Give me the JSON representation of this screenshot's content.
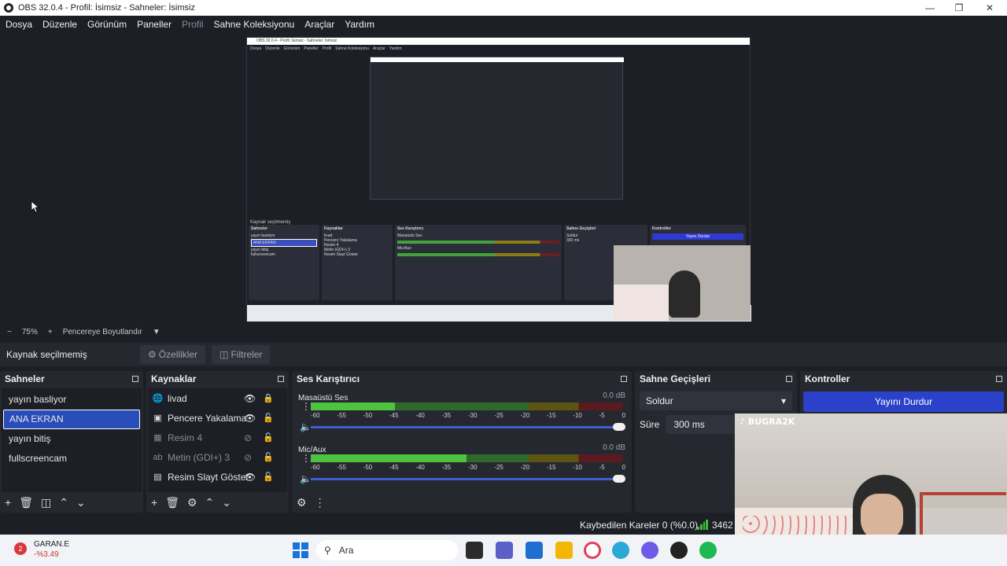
{
  "window": {
    "title": "OBS 32.0.4 - Profil: İsimsiz - Sahneler: İsimsiz"
  },
  "menu": [
    "Dosya",
    "Düzenle",
    "Görünüm",
    "Paneller",
    "Profil",
    "Sahne Koleksiyonu",
    "Araçlar",
    "Yardım"
  ],
  "preview": {
    "zoom": "75%",
    "fit_label": "Pencereye Boyutlandır"
  },
  "context": {
    "label": "Kaynak seçilmemiş",
    "properties": "Özellikler",
    "filters": "Filtreler"
  },
  "scenes": {
    "title": "Sahneler",
    "items": [
      "yayın basliyor",
      "ANA EKRAN",
      "yayın bitiş",
      "fullscreencam"
    ],
    "selected_index": 1
  },
  "sources": {
    "title": "Kaynaklar",
    "items": [
      {
        "label": "livad",
        "icon": "globe-icon",
        "visible": true
      },
      {
        "label": "Pencere Yakalama",
        "icon": "window-icon",
        "visible": true
      },
      {
        "label": "Resim 4",
        "icon": "image-icon",
        "visible": false
      },
      {
        "label": "Metin (GDI+) 3",
        "icon": "text-icon",
        "visible": false
      },
      {
        "label": "Resim Slayt Göster",
        "icon": "slideshow-icon",
        "visible": true
      }
    ]
  },
  "mixer": {
    "title": "Ses Karıştırıcı",
    "scale": [
      "-60",
      "-55",
      "-50",
      "-45",
      "-40",
      "-35",
      "-30",
      "-25",
      "-20",
      "-15",
      "-10",
      "-5",
      "0"
    ],
    "channels": [
      {
        "name": "Masaüstü Ses",
        "db": "0.0 dB",
        "level": 0.27,
        "peak": 0.29
      },
      {
        "name": "Mic/Aux",
        "db": "0.0 dB",
        "level": 0.5,
        "peak": 0.52
      }
    ]
  },
  "transitions": {
    "title": "Sahne Geçişleri",
    "selected": "Soldur",
    "duration_label": "Süre",
    "duration_value": "300 ms"
  },
  "controls": {
    "title": "Kontroller",
    "stop_stream": "Yayını Durdur"
  },
  "status": {
    "dropped_frames": "Kaybedilen Kareler 0 (%0.0)",
    "bitrate": "3462"
  },
  "taskbar": {
    "stock_name": "GARAN.E",
    "stock_change": "-%3.49",
    "stock_badge": "2",
    "search_placeholder": "Ara"
  },
  "webcam": {
    "tag": "BUGRA2K"
  },
  "colors": {
    "accent": "#284cb8",
    "stop_button": "#2b41c9",
    "meter_green": "#4cc440"
  }
}
